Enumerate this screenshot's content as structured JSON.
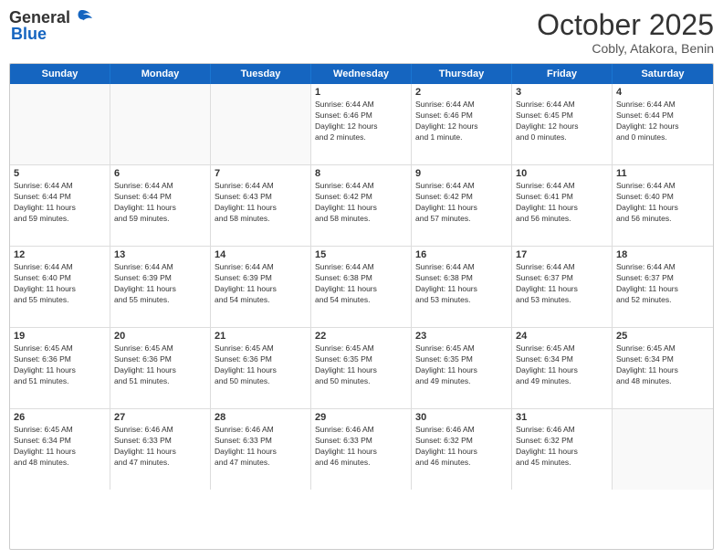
{
  "logo": {
    "general": "General",
    "blue": "Blue"
  },
  "title": {
    "month": "October 2025",
    "location": "Cobly, Atakora, Benin"
  },
  "days": [
    "Sunday",
    "Monday",
    "Tuesday",
    "Wednesday",
    "Thursday",
    "Friday",
    "Saturday"
  ],
  "rows": [
    [
      {
        "day": "",
        "lines": []
      },
      {
        "day": "",
        "lines": []
      },
      {
        "day": "",
        "lines": []
      },
      {
        "day": "1",
        "lines": [
          "Sunrise: 6:44 AM",
          "Sunset: 6:46 PM",
          "Daylight: 12 hours",
          "and 2 minutes."
        ]
      },
      {
        "day": "2",
        "lines": [
          "Sunrise: 6:44 AM",
          "Sunset: 6:46 PM",
          "Daylight: 12 hours",
          "and 1 minute."
        ]
      },
      {
        "day": "3",
        "lines": [
          "Sunrise: 6:44 AM",
          "Sunset: 6:45 PM",
          "Daylight: 12 hours",
          "and 0 minutes."
        ]
      },
      {
        "day": "4",
        "lines": [
          "Sunrise: 6:44 AM",
          "Sunset: 6:44 PM",
          "Daylight: 12 hours",
          "and 0 minutes."
        ]
      }
    ],
    [
      {
        "day": "5",
        "lines": [
          "Sunrise: 6:44 AM",
          "Sunset: 6:44 PM",
          "Daylight: 11 hours",
          "and 59 minutes."
        ]
      },
      {
        "day": "6",
        "lines": [
          "Sunrise: 6:44 AM",
          "Sunset: 6:44 PM",
          "Daylight: 11 hours",
          "and 59 minutes."
        ]
      },
      {
        "day": "7",
        "lines": [
          "Sunrise: 6:44 AM",
          "Sunset: 6:43 PM",
          "Daylight: 11 hours",
          "and 58 minutes."
        ]
      },
      {
        "day": "8",
        "lines": [
          "Sunrise: 6:44 AM",
          "Sunset: 6:42 PM",
          "Daylight: 11 hours",
          "and 58 minutes."
        ]
      },
      {
        "day": "9",
        "lines": [
          "Sunrise: 6:44 AM",
          "Sunset: 6:42 PM",
          "Daylight: 11 hours",
          "and 57 minutes."
        ]
      },
      {
        "day": "10",
        "lines": [
          "Sunrise: 6:44 AM",
          "Sunset: 6:41 PM",
          "Daylight: 11 hours",
          "and 56 minutes."
        ]
      },
      {
        "day": "11",
        "lines": [
          "Sunrise: 6:44 AM",
          "Sunset: 6:40 PM",
          "Daylight: 11 hours",
          "and 56 minutes."
        ]
      }
    ],
    [
      {
        "day": "12",
        "lines": [
          "Sunrise: 6:44 AM",
          "Sunset: 6:40 PM",
          "Daylight: 11 hours",
          "and 55 minutes."
        ]
      },
      {
        "day": "13",
        "lines": [
          "Sunrise: 6:44 AM",
          "Sunset: 6:39 PM",
          "Daylight: 11 hours",
          "and 55 minutes."
        ]
      },
      {
        "day": "14",
        "lines": [
          "Sunrise: 6:44 AM",
          "Sunset: 6:39 PM",
          "Daylight: 11 hours",
          "and 54 minutes."
        ]
      },
      {
        "day": "15",
        "lines": [
          "Sunrise: 6:44 AM",
          "Sunset: 6:38 PM",
          "Daylight: 11 hours",
          "and 54 minutes."
        ]
      },
      {
        "day": "16",
        "lines": [
          "Sunrise: 6:44 AM",
          "Sunset: 6:38 PM",
          "Daylight: 11 hours",
          "and 53 minutes."
        ]
      },
      {
        "day": "17",
        "lines": [
          "Sunrise: 6:44 AM",
          "Sunset: 6:37 PM",
          "Daylight: 11 hours",
          "and 53 minutes."
        ]
      },
      {
        "day": "18",
        "lines": [
          "Sunrise: 6:44 AM",
          "Sunset: 6:37 PM",
          "Daylight: 11 hours",
          "and 52 minutes."
        ]
      }
    ],
    [
      {
        "day": "19",
        "lines": [
          "Sunrise: 6:45 AM",
          "Sunset: 6:36 PM",
          "Daylight: 11 hours",
          "and 51 minutes."
        ]
      },
      {
        "day": "20",
        "lines": [
          "Sunrise: 6:45 AM",
          "Sunset: 6:36 PM",
          "Daylight: 11 hours",
          "and 51 minutes."
        ]
      },
      {
        "day": "21",
        "lines": [
          "Sunrise: 6:45 AM",
          "Sunset: 6:36 PM",
          "Daylight: 11 hours",
          "and 50 minutes."
        ]
      },
      {
        "day": "22",
        "lines": [
          "Sunrise: 6:45 AM",
          "Sunset: 6:35 PM",
          "Daylight: 11 hours",
          "and 50 minutes."
        ]
      },
      {
        "day": "23",
        "lines": [
          "Sunrise: 6:45 AM",
          "Sunset: 6:35 PM",
          "Daylight: 11 hours",
          "and 49 minutes."
        ]
      },
      {
        "day": "24",
        "lines": [
          "Sunrise: 6:45 AM",
          "Sunset: 6:34 PM",
          "Daylight: 11 hours",
          "and 49 minutes."
        ]
      },
      {
        "day": "25",
        "lines": [
          "Sunrise: 6:45 AM",
          "Sunset: 6:34 PM",
          "Daylight: 11 hours",
          "and 48 minutes."
        ]
      }
    ],
    [
      {
        "day": "26",
        "lines": [
          "Sunrise: 6:45 AM",
          "Sunset: 6:34 PM",
          "Daylight: 11 hours",
          "and 48 minutes."
        ]
      },
      {
        "day": "27",
        "lines": [
          "Sunrise: 6:46 AM",
          "Sunset: 6:33 PM",
          "Daylight: 11 hours",
          "and 47 minutes."
        ]
      },
      {
        "day": "28",
        "lines": [
          "Sunrise: 6:46 AM",
          "Sunset: 6:33 PM",
          "Daylight: 11 hours",
          "and 47 minutes."
        ]
      },
      {
        "day": "29",
        "lines": [
          "Sunrise: 6:46 AM",
          "Sunset: 6:33 PM",
          "Daylight: 11 hours",
          "and 46 minutes."
        ]
      },
      {
        "day": "30",
        "lines": [
          "Sunrise: 6:46 AM",
          "Sunset: 6:32 PM",
          "Daylight: 11 hours",
          "and 46 minutes."
        ]
      },
      {
        "day": "31",
        "lines": [
          "Sunrise: 6:46 AM",
          "Sunset: 6:32 PM",
          "Daylight: 11 hours",
          "and 45 minutes."
        ]
      },
      {
        "day": "",
        "lines": []
      }
    ]
  ]
}
